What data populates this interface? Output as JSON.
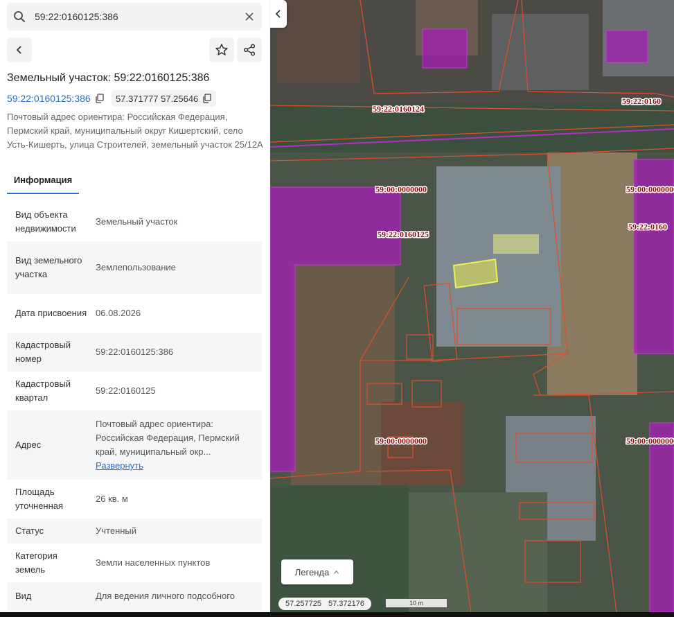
{
  "search": {
    "value": "59:22:0160125:386"
  },
  "header": {
    "title": "Земельный участок: 59:22:0160125:386",
    "cadastral_link": "59:22:0160125:386",
    "coords_chip": "57.371777 57.25646",
    "address": "Почтовый адрес ориентира: Российская Федерация, Пермский край, муниципальный округ Кишертский, село Усть-Кишерть, улица Строителей, земельный участок 25/12А"
  },
  "tabs": [
    {
      "label": "Информация",
      "active": true
    }
  ],
  "info_rows": [
    {
      "key": "Вид объекта недвижимости",
      "value": "Земельный участок"
    },
    {
      "key": "Вид земельного участка",
      "value": "Землепользование"
    },
    {
      "key": "Дата присвоения",
      "value": "06.08.2026"
    },
    {
      "key": "Кадастровый номер",
      "value": "59:22:0160125:386"
    },
    {
      "key": "Кадастровый квартал",
      "value": "59:22:0160125"
    },
    {
      "key": "Адрес",
      "value": "Почтовый адрес ориентира: Российская Федерация, Пермский край, муниципальный окр...",
      "action": "Развернуть"
    },
    {
      "key": "Площадь уточненная",
      "value": "26 кв. м"
    },
    {
      "key": "Статус",
      "value": "Учтенный"
    },
    {
      "key": "Категория земель",
      "value": "Земли населенных пунктов"
    },
    {
      "key": "Вид",
      "value": "Для ведения личного подсобного"
    }
  ],
  "map": {
    "labels": [
      "59:22:0160124",
      "59:22:0160",
      "59:00:0000000",
      "59:00:0000000",
      "59:22:0160125",
      "59:22:0160",
      "59:00:0000000",
      "59:00:0000000"
    ],
    "legend_label": "Легенда",
    "coord_lat": "57.257725",
    "coord_lon": "57.372176",
    "scale_label": "10 m",
    "colors": {
      "parcel_outline": "#d9502f",
      "zone_fill": "#a020b0",
      "selected_fill": "#e6e84a",
      "label_text": "#8b0d0d"
    }
  },
  "icons": [
    "search-icon",
    "close-icon",
    "chevron-left-icon",
    "star-icon",
    "share-icon",
    "copy-icon",
    "chevron-up-icon"
  ]
}
